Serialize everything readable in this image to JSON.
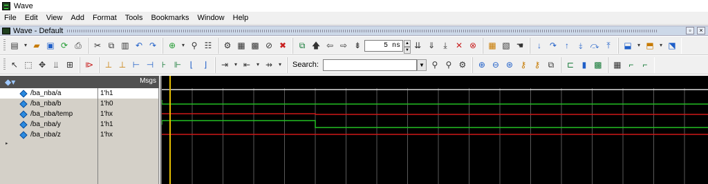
{
  "window": {
    "title": "Wave"
  },
  "menubar": {
    "items": [
      "File",
      "Edit",
      "View",
      "Add",
      "Format",
      "Tools",
      "Bookmarks",
      "Window",
      "Help"
    ]
  },
  "subwindow": {
    "title": "Wave - Default"
  },
  "toolbar": {
    "time_value": "5 ns",
    "search_label": "Search:",
    "search_value": ""
  },
  "wave_header": {
    "msgs_label": "Msgs"
  },
  "signals": [
    {
      "name": "/ba_nba/a",
      "value": "1'h1",
      "selected": true,
      "color": "#e0e0e0"
    },
    {
      "name": "/ba_nba/b",
      "value": "1'h0",
      "selected": false,
      "color": "#22c022"
    },
    {
      "name": "/ba_nba/temp",
      "value": "1'hx",
      "selected": false,
      "color": "#d01818"
    },
    {
      "name": "/ba_nba/y",
      "value": "1'h1",
      "selected": false,
      "color": "#22c022"
    },
    {
      "name": "/ba_nba/z",
      "value": "1'hx",
      "selected": false,
      "color": "#d01818"
    }
  ],
  "colors": {
    "cursor": "#e8c000",
    "grid": "#5a5a5a",
    "wave_bg": "#000000"
  }
}
